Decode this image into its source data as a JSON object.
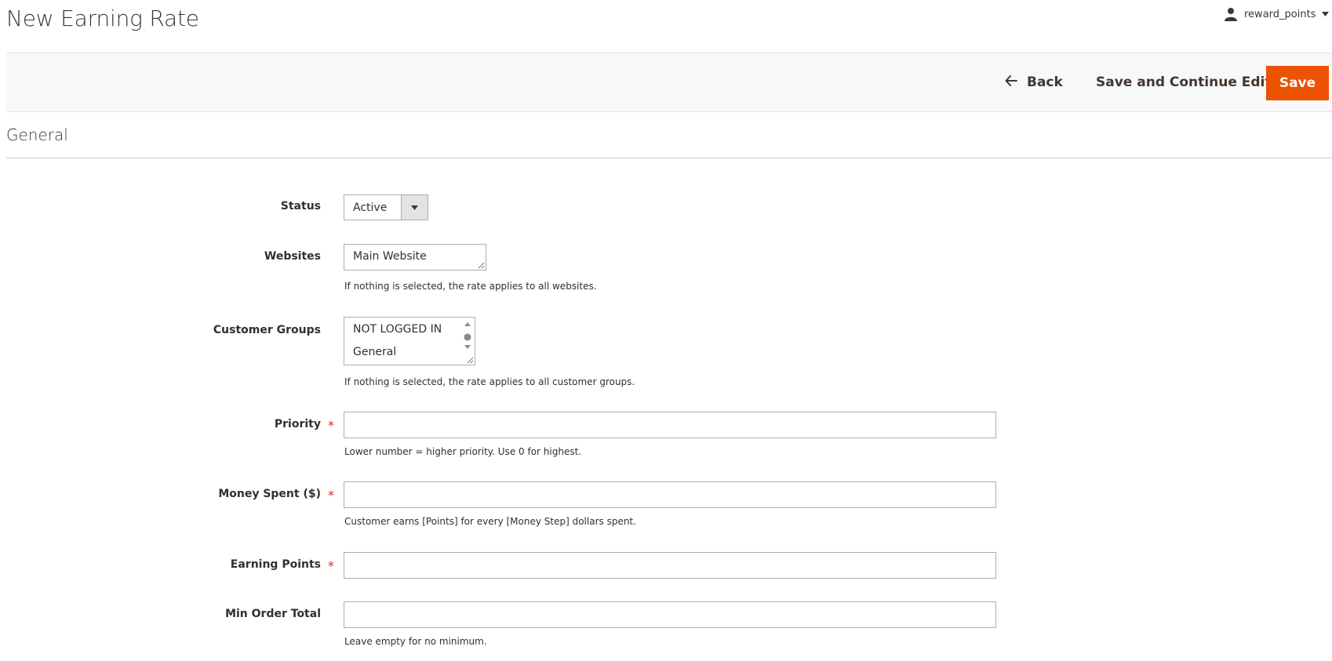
{
  "header": {
    "title": "New Earning Rate",
    "user": {
      "name": "reward_points"
    }
  },
  "actions": {
    "back_label": "Back",
    "save_continue_label": "Save and Continue Edit",
    "save_label": "Save"
  },
  "section": {
    "title": "General"
  },
  "form": {
    "status": {
      "label": "Status",
      "value": "Active"
    },
    "websites": {
      "label": "Websites",
      "options": [
        "Main Website"
      ],
      "note": "If nothing is selected, the rate applies to all websites."
    },
    "customer_groups": {
      "label": "Customer Groups",
      "options": [
        "NOT LOGGED IN",
        "General"
      ],
      "note": "If nothing is selected, the rate applies to all customer groups."
    },
    "priority": {
      "label": "Priority",
      "required_mark": "*",
      "value": "",
      "note": "Lower number = higher priority. Use 0 for highest."
    },
    "money_spent": {
      "label": "Money Spent ($)",
      "required_mark": "*",
      "value": "",
      "note": "Customer earns [Points] for every [Money Step] dollars spent."
    },
    "earning_points": {
      "label": "Earning Points",
      "required_mark": "*",
      "value": ""
    },
    "min_order_total": {
      "label": "Min Order Total",
      "value": "",
      "note": "Leave empty for no minimum."
    }
  },
  "colors": {
    "primary_button": "#eb5202",
    "required": "#e22626",
    "action_bar_bg": "#f8f8f8"
  },
  "icons": {
    "user": "user-icon",
    "back": "arrow-left-icon",
    "caret": "caret-down-icon"
  }
}
